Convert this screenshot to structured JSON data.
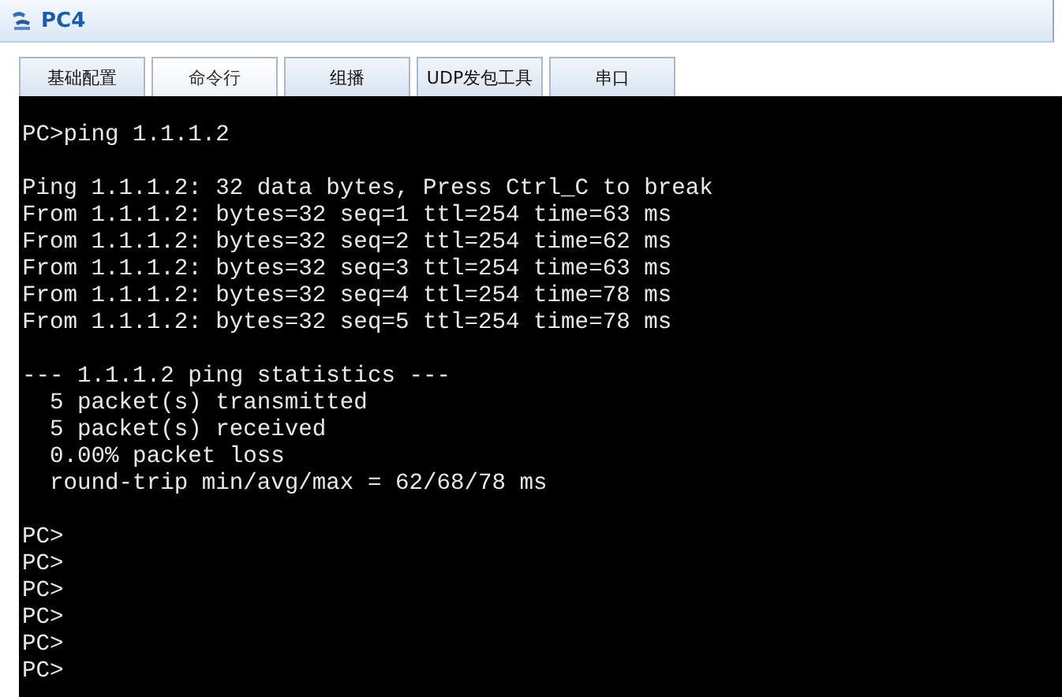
{
  "window": {
    "title": "PC4"
  },
  "tabs": [
    {
      "label": "基础配置",
      "selected": false
    },
    {
      "label": "命令行",
      "selected": true
    },
    {
      "label": "组播",
      "selected": false
    },
    {
      "label": "UDP发包工具",
      "selected": false
    },
    {
      "label": "串口",
      "selected": false
    }
  ],
  "terminal": {
    "blocks": [
      [
        "PC>ping 1.1.1.2"
      ],
      [
        "Ping 1.1.1.2: 32 data bytes, Press Ctrl_C to break",
        "From 1.1.1.2: bytes=32 seq=1 ttl=254 time=63 ms",
        "From 1.1.1.2: bytes=32 seq=2 ttl=254 time=62 ms",
        "From 1.1.1.2: bytes=32 seq=3 ttl=254 time=63 ms",
        "From 1.1.1.2: bytes=32 seq=4 ttl=254 time=78 ms",
        "From 1.1.1.2: bytes=32 seq=5 ttl=254 time=78 ms"
      ],
      [
        "--- 1.1.1.2 ping statistics ---",
        "  5 packet(s) transmitted",
        "  5 packet(s) received",
        "  0.00% packet loss",
        "  round-trip min/avg/max = 62/68/78 ms"
      ],
      [
        "PC>",
        "PC>",
        "PC>",
        "PC>",
        "PC>",
        "PC>"
      ]
    ]
  }
}
